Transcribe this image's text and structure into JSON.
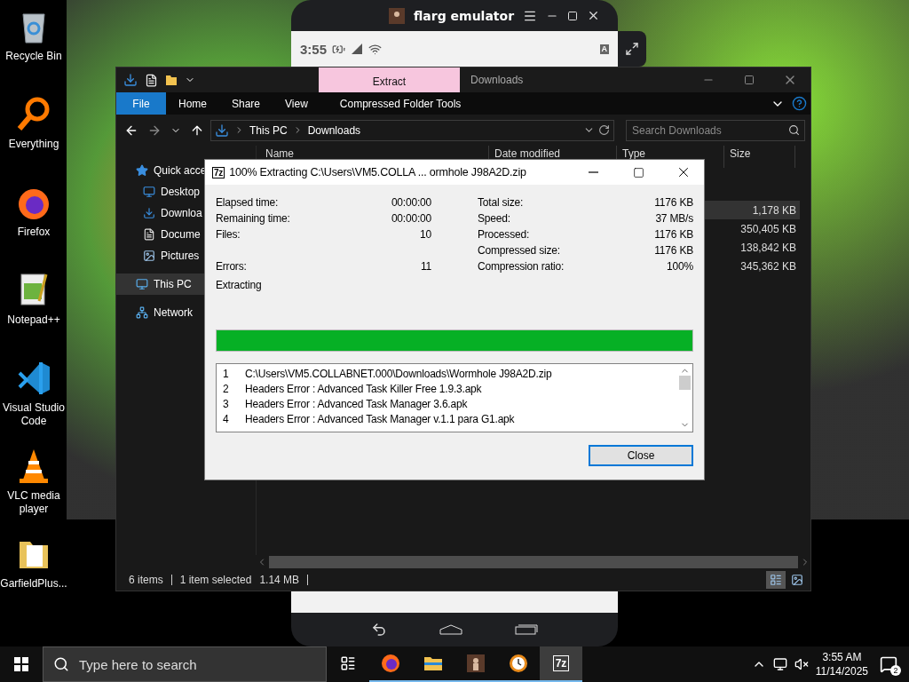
{
  "desktop_icons": [
    {
      "label": "Recycle Bin",
      "kind": "bin"
    },
    {
      "label": "Everything",
      "kind": "magnifier"
    },
    {
      "label": "Firefox",
      "kind": "browser"
    },
    {
      "label": "Notepad++",
      "kind": "notepad"
    },
    {
      "label": "Visual Studio Code",
      "kind": "code"
    },
    {
      "label": "VLC media player",
      "kind": "cone"
    },
    {
      "label": "GarfieldPlus...",
      "kind": "folder"
    }
  ],
  "emulator": {
    "title": "flarg emulator",
    "clock": "3:55",
    "notice_letter": "A"
  },
  "explorer": {
    "context_tab": "Extract",
    "title": "Downloads",
    "file_tab": "File",
    "ribbon_tabs": [
      "Home",
      "Share",
      "View",
      "Compressed Folder Tools"
    ],
    "breadcrumbs": [
      "This PC",
      "Downloads"
    ],
    "search": {
      "placeholder": "Search Downloads"
    },
    "nav": [
      {
        "label": "Quick acce",
        "kind": "star",
        "selected": false,
        "children": [
          {
            "label": "Desktop",
            "kind": "desktop",
            "selected": false
          },
          {
            "label": "Downloa",
            "kind": "download",
            "selected": false
          },
          {
            "label": "Docume",
            "kind": "document",
            "selected": false
          },
          {
            "label": "Pictures",
            "kind": "picture",
            "selected": false
          }
        ]
      },
      {
        "label": "This PC",
        "kind": "computer",
        "selected": true
      },
      {
        "label": "Network",
        "kind": "network",
        "selected": false
      }
    ],
    "columns": [
      "Name",
      "Date modified",
      "Type",
      "Size"
    ],
    "rows": [
      {
        "size": "1,178 KB",
        "selected": true
      },
      {
        "size": "350,405 KB",
        "selected": false
      },
      {
        "size": "138,842 KB",
        "selected": false
      },
      {
        "size": "345,362 KB",
        "selected": false
      }
    ],
    "status_bar": {
      "count": "6 items",
      "selection": "1 item selected",
      "selection_size": "1.14 MB"
    }
  },
  "dialog": {
    "logo": "7z",
    "title": "100% Extracting C:\\Users\\VM5.COLLA ... ormhole J98A2D.zip",
    "stats_left": [
      {
        "label": "Elapsed time:",
        "value": "00:00:00"
      },
      {
        "label": "Remaining time:",
        "value": "00:00:00"
      },
      {
        "label": "Files:",
        "value": "10"
      },
      {
        "label": "Errors:",
        "value": "11"
      }
    ],
    "status": "Extracting",
    "stats_right": [
      {
        "label": "Total size:",
        "value": "1176 KB"
      },
      {
        "label": "Speed:",
        "value": "37 MB/s"
      },
      {
        "label": "Processed:",
        "value": "1176 KB"
      },
      {
        "label": "Compressed size:",
        "value": "1176 KB"
      },
      {
        "label": "Compression ratio:",
        "value": "100%"
      }
    ],
    "progress": {
      "level": 1
    },
    "log": [
      {
        "index": "1",
        "text": "C:\\Users\\VM5.COLLABNET.000\\Downloads\\Wormhole J98A2D.zip"
      },
      {
        "index": "2",
        "text": "Headers Error : Advanced Task Killer Free 1.9.3.apk"
      },
      {
        "index": "3",
        "text": "Headers Error : Advanced Task Manager 3.6.apk"
      },
      {
        "index": "4",
        "text": "Headers Error : Advanced Task Manager v.1.1 para G1.apk"
      }
    ],
    "button": "Close"
  },
  "taskbar": {
    "search": {
      "placeholder": "Type here to search"
    },
    "apps": [
      {
        "kind": "browser",
        "selected": false
      },
      {
        "kind": "folder",
        "selected": false
      },
      {
        "kind": "emulator",
        "selected": false
      },
      {
        "kind": "clock",
        "selected": false
      },
      {
        "kind": "archive",
        "label": "7z",
        "selected": true
      }
    ],
    "time": "3:55 AM",
    "date": "11/14/2025",
    "notifications": "2"
  }
}
